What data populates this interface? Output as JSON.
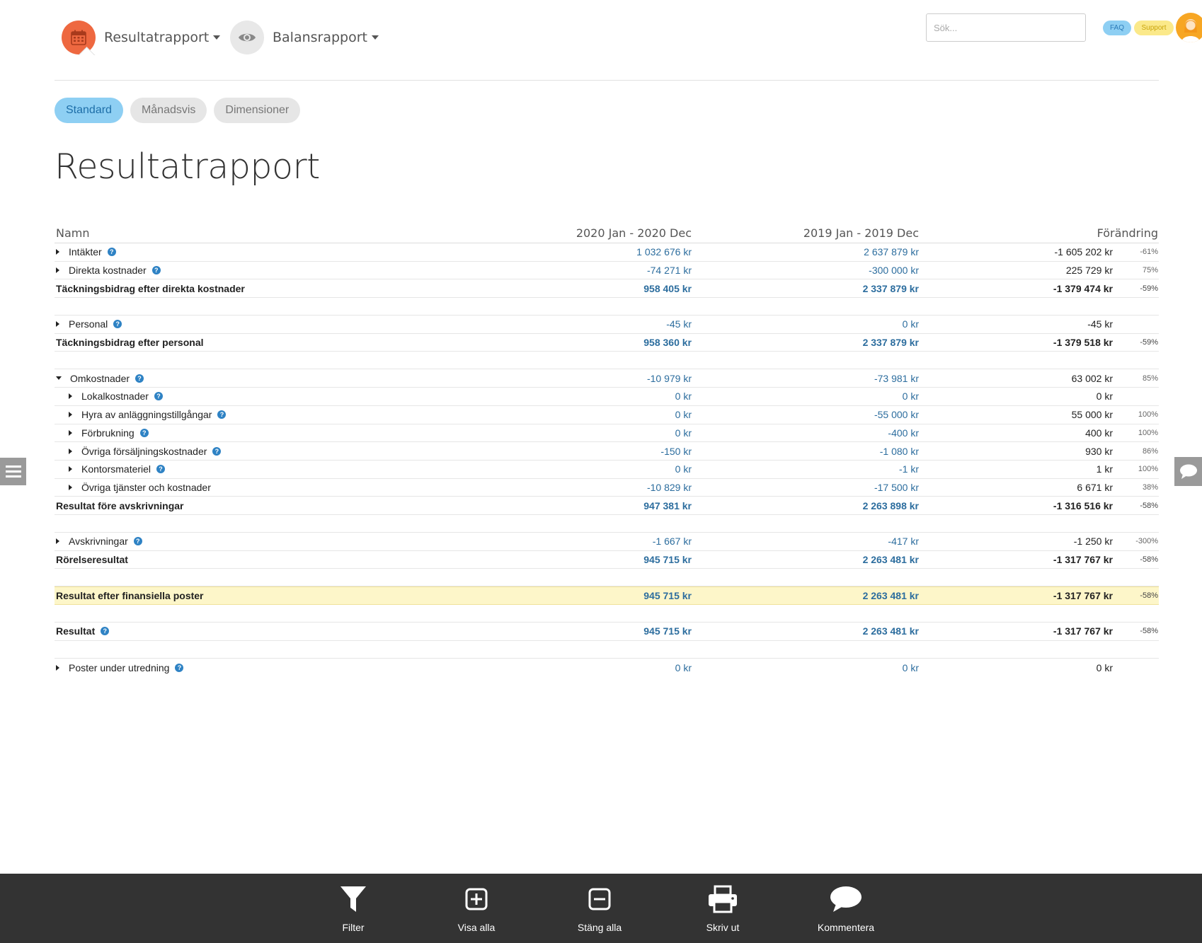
{
  "nav": {
    "report1_label": "Resultatrapport",
    "report2_label": "Balansrapport"
  },
  "search": {
    "placeholder": "Sök..."
  },
  "badges": {
    "faq": "FAQ",
    "support": "Support"
  },
  "tabs": [
    {
      "label": "Standard",
      "active": true
    },
    {
      "label": "Månadsvis",
      "active": false
    },
    {
      "label": "Dimensioner",
      "active": false
    }
  ],
  "page_title": "Resultatrapport",
  "table": {
    "headers": {
      "name": "Namn",
      "col1": "2020 Jan - 2020 Dec",
      "col2": "2019 Jan - 2019 Dec",
      "col3": "Förändring"
    },
    "rows": [
      {
        "name": "Intäkter",
        "c1": "1 032 676 kr",
        "c2": "2 637 879 kr",
        "c3": "-1 605 202 kr",
        "pct": "-61%"
      },
      {
        "name": "Direkta kostnader",
        "c1": "-74 271 kr",
        "c2": "-300 000 kr",
        "c3": "225 729 kr",
        "pct": "75%"
      },
      {
        "name": "Täckningsbidrag efter direkta kostnader",
        "c1": "958 405 kr",
        "c2": "2 337 879 kr",
        "c3": "-1 379 474 kr",
        "pct": "-59%"
      },
      {
        "name": "Personal",
        "c1": "-45 kr",
        "c2": "0 kr",
        "c3": "-45 kr",
        "pct": ""
      },
      {
        "name": "Täckningsbidrag efter personal",
        "c1": "958 360 kr",
        "c2": "2 337 879 kr",
        "c3": "-1 379 518 kr",
        "pct": "-59%"
      },
      {
        "name": "Omkostnader",
        "c1": "-10 979 kr",
        "c2": "-73 981 kr",
        "c3": "63 002 kr",
        "pct": "85%"
      },
      {
        "name": "Lokalkostnader",
        "c1": "0 kr",
        "c2": "0 kr",
        "c3": "0 kr",
        "pct": ""
      },
      {
        "name": "Hyra av anläggningstillgångar",
        "c1": "0 kr",
        "c2": "-55 000 kr",
        "c3": "55 000 kr",
        "pct": "100%"
      },
      {
        "name": "Förbrukning",
        "c1": "0 kr",
        "c2": "-400 kr",
        "c3": "400 kr",
        "pct": "100%"
      },
      {
        "name": "Övriga försäljningskostnader",
        "c1": "-150 kr",
        "c2": "-1 080 kr",
        "c3": "930 kr",
        "pct": "86%"
      },
      {
        "name": "Kontorsmateriel",
        "c1": "0 kr",
        "c2": "-1 kr",
        "c3": "1 kr",
        "pct": "100%"
      },
      {
        "name": "Övriga tjänster och kostnader",
        "c1": "-10 829 kr",
        "c2": "-17 500 kr",
        "c3": "6 671 kr",
        "pct": "38%"
      },
      {
        "name": "Resultat före avskrivningar",
        "c1": "947 381 kr",
        "c2": "2 263 898 kr",
        "c3": "-1 316 516 kr",
        "pct": "-58%"
      },
      {
        "name": "Avskrivningar",
        "c1": "-1 667 kr",
        "c2": "-417 kr",
        "c3": "-1 250 kr",
        "pct": "-300%"
      },
      {
        "name": "Rörelseresultat",
        "c1": "945 715 kr",
        "c2": "2 263 481 kr",
        "c3": "-1 317 767 kr",
        "pct": "-58%"
      },
      {
        "name": "Resultat efter finansiella poster",
        "c1": "945 715 kr",
        "c2": "2 263 481 kr",
        "c3": "-1 317 767 kr",
        "pct": "-58%"
      },
      {
        "name": "Resultat",
        "c1": "945 715 kr",
        "c2": "2 263 481 kr",
        "c3": "-1 317 767 kr",
        "pct": "-58%"
      },
      {
        "name": "Poster under utredning",
        "c1": "0 kr",
        "c2": "0 kr",
        "c3": "0 kr",
        "pct": ""
      }
    ]
  },
  "bottombar": {
    "filter": "Filter",
    "show_all": "Visa alla",
    "close_all": "Stäng alla",
    "print": "Skriv ut",
    "comment": "Kommentera"
  },
  "icons": {
    "report1": "calendar-icon",
    "report2": "eye-icon",
    "help": "question-icon",
    "left_side": "menu-icon",
    "right_side": "chat-icon"
  },
  "colors": {
    "accent_orange": "#ee6840",
    "active_tab": "#8ecff3",
    "value_blue": "#2c6d9e",
    "highlight_row": "#fdf6c9",
    "bottombar": "#333333"
  }
}
